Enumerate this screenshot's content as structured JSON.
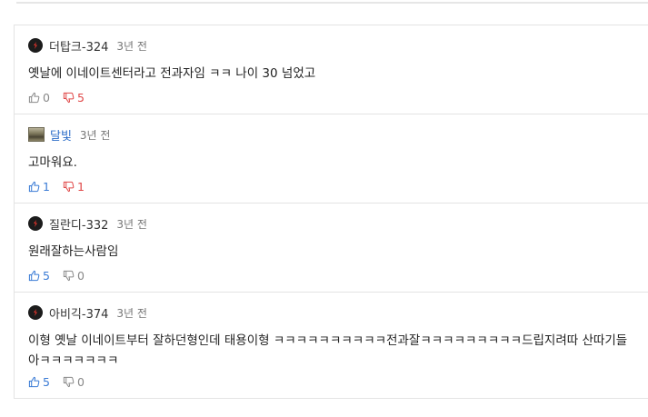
{
  "comments": [
    {
      "nick": "더탑크-324",
      "time": "3년 전",
      "text": "옛날에 이네이트센터라고 전과자임 ㅋㅋ 나이 30 넘었고",
      "likes": "0",
      "dislikes": "5",
      "avatar": "logo-badge-icon"
    },
    {
      "nick": "달빛",
      "time": "3년 전",
      "text": "고마워요.",
      "likes": "1",
      "dislikes": "1",
      "avatar": "photo-avatar"
    },
    {
      "nick": "질란디-332",
      "time": "3년 전",
      "text": "원래잘하는사람임",
      "likes": "5",
      "dislikes": "0",
      "avatar": "logo-badge-icon"
    },
    {
      "nick": "아비긱-374",
      "time": "3년 전",
      "text": "이형 옛날 이네이트부터 잘하던형인데 태용이형 ㅋㅋㅋㅋㅋㅋㅋㅋㅋㅋ전과잘ㅋㅋㅋㅋㅋㅋㅋㅋㅋ드립지려따 산따기들아ㅋㅋㅋㅋㅋㅋㅋ",
      "likes": "5",
      "dislikes": "0",
      "avatar": "logo-badge-icon"
    }
  ],
  "colors": {
    "link_blue": "#2b6cc8",
    "like_blue": "#3a7bd5",
    "dislike_red": "#e04848",
    "muted": "#888888"
  }
}
